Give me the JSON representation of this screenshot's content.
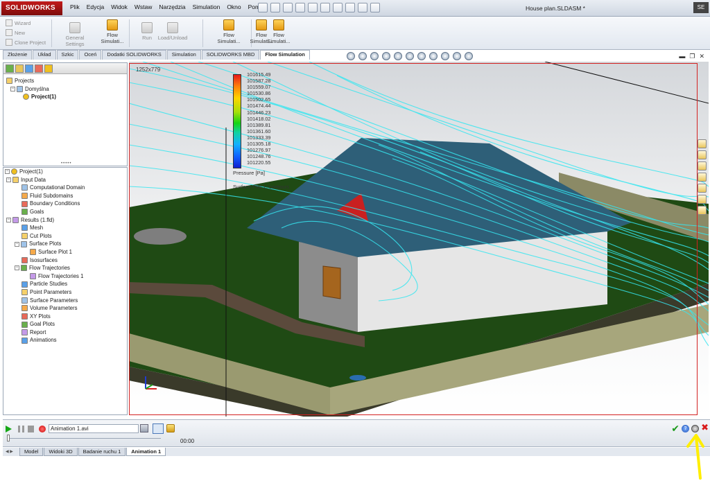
{
  "app": {
    "logo_text": "SOLIDWORKS",
    "document_title": "House plan.SLDASM *",
    "menu": [
      "Plik",
      "Edycja",
      "Widok",
      "Wstaw",
      "Narzędzia",
      "Simulation",
      "Okno",
      "Pomoc"
    ],
    "title_button": "SE"
  },
  "ribbon": {
    "wizard": "Wizard",
    "new": "New",
    "clone_project": "Clone Project",
    "general_settings": "General Settings",
    "flow_simulation_1": "Flow Simulati...",
    "run": "Run",
    "load_unload": "Load/Unload",
    "flow_simulation_2": "Flow Simulati...",
    "flow_simulation_3": "Flow Simulati...",
    "flow_simulation_4": "Flow Simulati..."
  },
  "command_tabs": [
    "Złożenie",
    "Układ",
    "Szkic",
    "Oceń",
    "Dodatki SOLIDWORKS",
    "Simulation",
    "SOLIDWORKS MBD",
    "Flow Simulation"
  ],
  "active_command_tab": "Flow Simulation",
  "projects_tree": {
    "root": "Projects",
    "config": "Domyślna",
    "project": "Project(1)"
  },
  "analysis_tree": {
    "root": "Project(1)",
    "items": [
      {
        "label": "Input Data",
        "level": 1,
        "expander": "−"
      },
      {
        "label": "Computational Domain",
        "level": 2
      },
      {
        "label": "Fluid Subdomains",
        "level": 2
      },
      {
        "label": "Boundary Conditions",
        "level": 2
      },
      {
        "label": "Goals",
        "level": 2
      },
      {
        "label": "Results (1.fld)",
        "level": 1,
        "expander": "−"
      },
      {
        "label": "Mesh",
        "level": 2
      },
      {
        "label": "Cut Plots",
        "level": 2
      },
      {
        "label": "Surface Plots",
        "level": 2,
        "expander": "−"
      },
      {
        "label": "Surface Plot 1",
        "level": 3
      },
      {
        "label": "Isosurfaces",
        "level": 2
      },
      {
        "label": "Flow Trajectories",
        "level": 2,
        "expander": "−"
      },
      {
        "label": "Flow Trajectories 1",
        "level": 3
      },
      {
        "label": "Particle Studies",
        "level": 2
      },
      {
        "label": "Point Parameters",
        "level": 2
      },
      {
        "label": "Surface Parameters",
        "level": 2
      },
      {
        "label": "Volume Parameters",
        "level": 2
      },
      {
        "label": "XY Plots",
        "level": 2
      },
      {
        "label": "Goal Plots",
        "level": 2
      },
      {
        "label": "Report",
        "level": 2
      },
      {
        "label": "Animations",
        "level": 2
      }
    ]
  },
  "viewport": {
    "resolution_label": "1252x779",
    "legend_values": [
      "101615.49",
      "101587.28",
      "101559.07",
      "101530.86",
      "101502.65",
      "101474.44",
      "101446.23",
      "101418.02",
      "101389.81",
      "101361.60",
      "101333.39",
      "101305.18",
      "101276.97",
      "101248.76",
      "101220.55"
    ],
    "legend_title": "Pressure [Pa]",
    "legend_subtitle": "Surface Plot 1: contours",
    "frame_color": "#d32020"
  },
  "animation_bar": {
    "file_name": "Animation 1.avi",
    "time": "00:00",
    "progress": 0
  },
  "bottom_tabs": [
    "Model",
    "Widoki 3D",
    "Badanie ruchu 1",
    "Animation 1"
  ],
  "active_bottom_tab": "Animation 1",
  "colors": {
    "annotation_arrow": "#ffee00",
    "ok": "#1c9a1c",
    "close": "#d91a1a"
  }
}
